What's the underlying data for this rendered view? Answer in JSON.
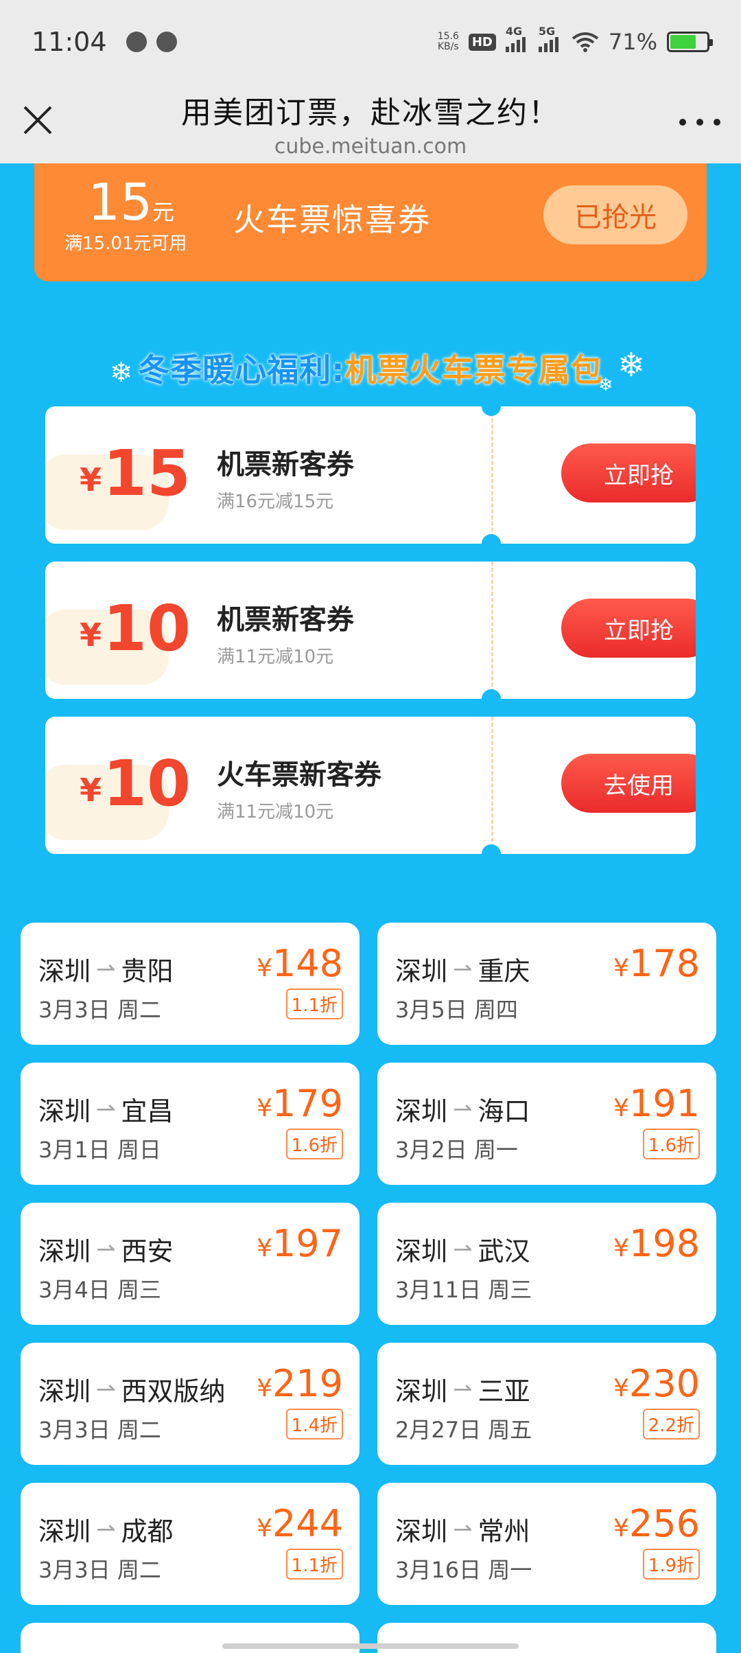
{
  "status_bar": {
    "time": "11:04",
    "net_speed_value": "15.6",
    "net_speed_unit": "KB/s",
    "hd_label": "HD",
    "signal_4g": "4G",
    "signal_5g": "5G",
    "battery_percent": "71%",
    "battery_level": 0.71
  },
  "header": {
    "title": "用美团订票，赴冰雪之约！",
    "url": "cube.meituan.com"
  },
  "surprise_coupon": {
    "amount": "15",
    "unit": "元",
    "condition": "满15.01元可用",
    "name": "火车票惊喜券",
    "button": "已抢光"
  },
  "pack_banner": {
    "text_a": "冬季暖心福利:",
    "text_b": "机票火车票专属包"
  },
  "new_customer_coupons": [
    {
      "yen": "¥",
      "amount": "15",
      "title": "机票新客券",
      "condition": "满16元减15元",
      "button": "立即抢"
    },
    {
      "yen": "¥",
      "amount": "10",
      "title": "机票新客券",
      "condition": "满11元减10元",
      "button": "立即抢"
    },
    {
      "yen": "¥",
      "amount": "10",
      "title": "火车票新客券",
      "condition": "满11元减10元",
      "button": "去使用"
    }
  ],
  "routes": [
    {
      "from": "深圳",
      "to": "贵阳",
      "date": "3月3日 周二",
      "price": "148",
      "discount": "1.1折"
    },
    {
      "from": "深圳",
      "to": "重庆",
      "date": "3月5日 周四",
      "price": "178",
      "discount": ""
    },
    {
      "from": "深圳",
      "to": "宜昌",
      "date": "3月1日 周日",
      "price": "179",
      "discount": "1.6折"
    },
    {
      "from": "深圳",
      "to": "海口",
      "date": "3月2日 周一",
      "price": "191",
      "discount": "1.6折"
    },
    {
      "from": "深圳",
      "to": "西安",
      "date": "3月4日 周三",
      "price": "197",
      "discount": ""
    },
    {
      "from": "深圳",
      "to": "武汉",
      "date": "3月11日 周三",
      "price": "198",
      "discount": ""
    },
    {
      "from": "深圳",
      "to": "西双版纳",
      "date": "3月3日 周二",
      "price": "219",
      "discount": "1.4折"
    },
    {
      "from": "深圳",
      "to": "三亚",
      "date": "2月27日 周五",
      "price": "230",
      "discount": "2.2折"
    },
    {
      "from": "深圳",
      "to": "成都",
      "date": "3月3日 周二",
      "price": "244",
      "discount": "1.1折"
    },
    {
      "from": "深圳",
      "to": "常州",
      "date": "3月16日 周一",
      "price": "256",
      "discount": "1.9折"
    }
  ],
  "yen_symbol": "¥",
  "colors": {
    "page_bg": "#16baf4",
    "orange": "#ff8a35",
    "price": "#ff6414",
    "coupon_red": "#f2462e"
  }
}
